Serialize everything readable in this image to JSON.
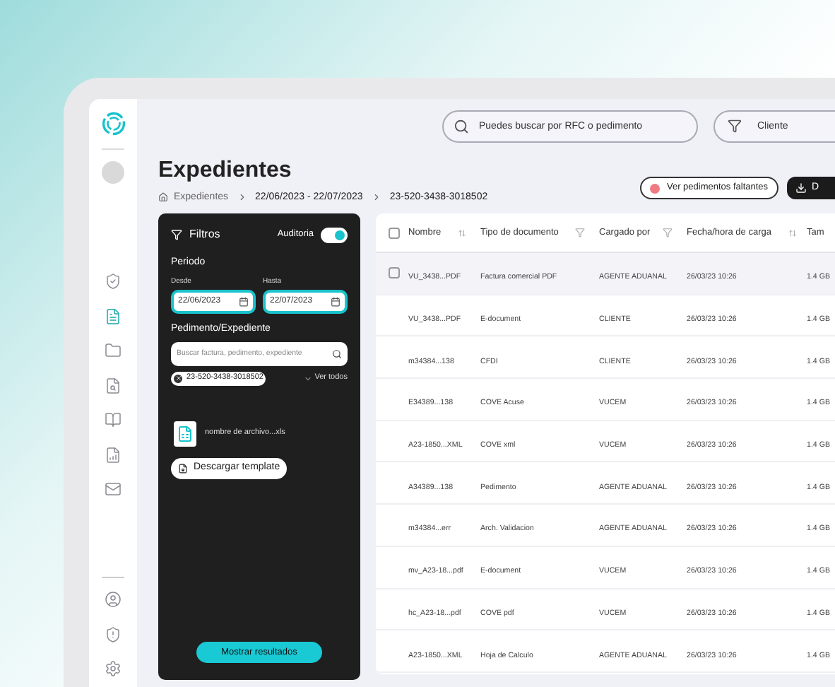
{
  "sidebar": {
    "items": [
      {
        "selected": false
      },
      {
        "selected": true
      },
      {
        "selected": false
      },
      {
        "selected": false
      },
      {
        "selected": false
      },
      {
        "selected": false
      },
      {
        "selected": false
      }
    ],
    "bottom_items": [
      {
        "selected": false
      },
      {
        "selected": false
      },
      {
        "selected": false
      }
    ]
  },
  "search": {
    "placeholder": "Puedes buscar por RFC o pedimento"
  },
  "client_filter": {
    "placeholder": "Cliente"
  },
  "title": "Expedientes",
  "breadcrumb": [
    "Expedientes",
    "22/06/2023 - 22/07/2023",
    "23-520-3438-3018502"
  ],
  "actions": [
    {
      "kind": "alert",
      "label": "Ver pedimentos faltantes"
    },
    {
      "kind": "download",
      "label": "D"
    }
  ],
  "filters": {
    "title": "Filtros",
    "audit_label": "Auditoria",
    "audit_on": true,
    "period_label": "Periodo",
    "from_label": "Desde",
    "from_value": "22/06/2023",
    "to_label": "Hasta",
    "to_value": "22/07/2023",
    "ped_label": "Pedimento/Expediente",
    "ped_placeholder": "Buscar factura, pedimento, expediente",
    "chips": [
      "23-520-3438-3018502"
    ],
    "see_all": "Ver todos",
    "file_name": "nombre de archivo...xls",
    "template_button": "Descargar template",
    "submit_button": "Mostrar resultados"
  },
  "table": {
    "select_all_checked": false,
    "columns": [
      {
        "label": "Nombre",
        "kind": "sort"
      },
      {
        "label": "Tipo de documento",
        "kind": "filter"
      },
      {
        "label": "Cargado por",
        "kind": "filter"
      },
      {
        "label": "Fecha/hora de carga",
        "kind": "sort"
      },
      {
        "label": "Tam",
        "kind": "none"
      }
    ],
    "rows": [
      {
        "highlighted": true,
        "cells": [
          "VU_3438...PDF",
          "Factura comercial PDF",
          "AGENTE ADUANAL",
          "26/03/23 10:26",
          "1.4 GB"
        ]
      },
      {
        "highlighted": false,
        "cells": [
          "VU_3438...PDF",
          "E-document",
          "CLIENTE",
          "26/03/23 10:26",
          "1.4 GB"
        ]
      },
      {
        "highlighted": false,
        "cells": [
          "m34384...138",
          "CFDI",
          "CLIENTE",
          "26/03/23 10:26",
          "1.4 GB"
        ]
      },
      {
        "highlighted": false,
        "cells": [
          "E34389...138",
          "COVE Acuse",
          "VUCEM",
          "26/03/23 10:26",
          "1.4 GB"
        ]
      },
      {
        "highlighted": false,
        "cells": [
          "A23-1850...XML",
          "COVE xml",
          "VUCEM",
          "26/03/23 10:26",
          "1.4 GB"
        ]
      },
      {
        "highlighted": false,
        "cells": [
          "A34389...138",
          "Pedimento",
          "AGENTE ADUANAL",
          "26/03/23 10:26",
          "1.4 GB"
        ]
      },
      {
        "highlighted": false,
        "cells": [
          "m34384...err",
          "Arch. Validacion",
          "AGENTE ADUANAL",
          "26/03/23 10:26",
          "1.4 GB"
        ]
      },
      {
        "highlighted": false,
        "cells": [
          "mv_A23-18...pdf",
          "E-document",
          "VUCEM",
          "26/03/23 10:26",
          "1.4 GB"
        ]
      },
      {
        "highlighted": false,
        "cells": [
          "hc_A23-18...pdf",
          "COVE pdf",
          "VUCEM",
          "26/03/23 10:26",
          "1.4 GB"
        ]
      },
      {
        "highlighted": false,
        "cells": [
          "A23-1850...XML",
          "Hoja de Calculo",
          "AGENTE ADUANAL",
          "26/03/23 10:26",
          "1.4 GB"
        ]
      }
    ]
  }
}
